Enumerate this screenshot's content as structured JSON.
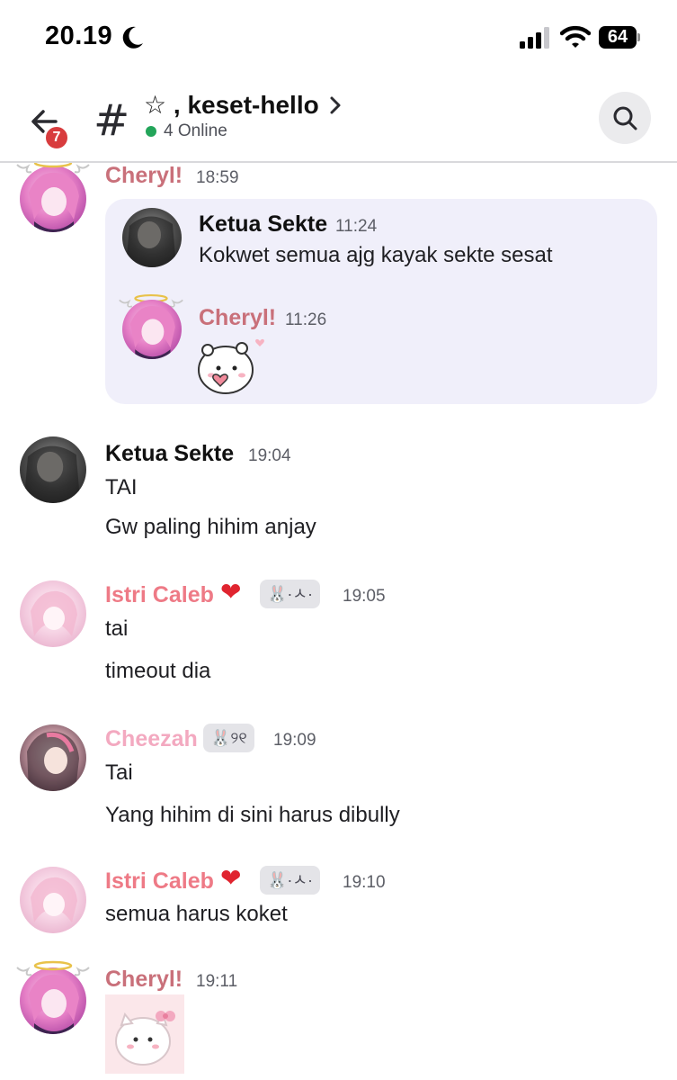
{
  "status_bar": {
    "time": "20.19",
    "battery": "64"
  },
  "header": {
    "back_badge": "7",
    "channel_hash": "#",
    "channel_name": "☆ , keset-hello",
    "online_text": "4 Online"
  },
  "colors": {
    "cheryl": "#c9707a",
    "istri_caleb": "#ee7a86",
    "cheezah": "#f3a9c0",
    "online": "#23a55a",
    "badge": "#d83c3e",
    "reply_bg": "#f0effa"
  },
  "messages": [
    {
      "author": "Cheryl!",
      "time": "18:59",
      "forwarded": [
        {
          "author": "Ketua Sekte",
          "time": "11:24",
          "text": "Kokwet semua ajg kayak sekte sesat"
        },
        {
          "author": "Cheryl!",
          "time": "11:26",
          "sticker": "bear-heart-sticker"
        }
      ]
    },
    {
      "author": "Ketua Sekte",
      "time": "19:04",
      "lines": [
        "TAI",
        "Gw paling hihim anjay"
      ]
    },
    {
      "author": "Istri Caleb",
      "badge": "❤",
      "tag": "🐰·ㅅ·",
      "time": "19:05",
      "lines": [
        "tai",
        "timeout dia"
      ]
    },
    {
      "author": "Cheezah",
      "tag": "🐰୨୧",
      "time": "19:09",
      "lines": [
        "Tai",
        "Yang hihim di sini harus dibully"
      ]
    },
    {
      "author": "Istri Caleb",
      "badge": "❤",
      "tag": "🐰·ㅅ·",
      "time": "19:10",
      "lines": [
        "semua harus koket"
      ]
    },
    {
      "author": "Cheryl!",
      "time": "19:11",
      "sticker": "cat-bow-sticker"
    }
  ]
}
